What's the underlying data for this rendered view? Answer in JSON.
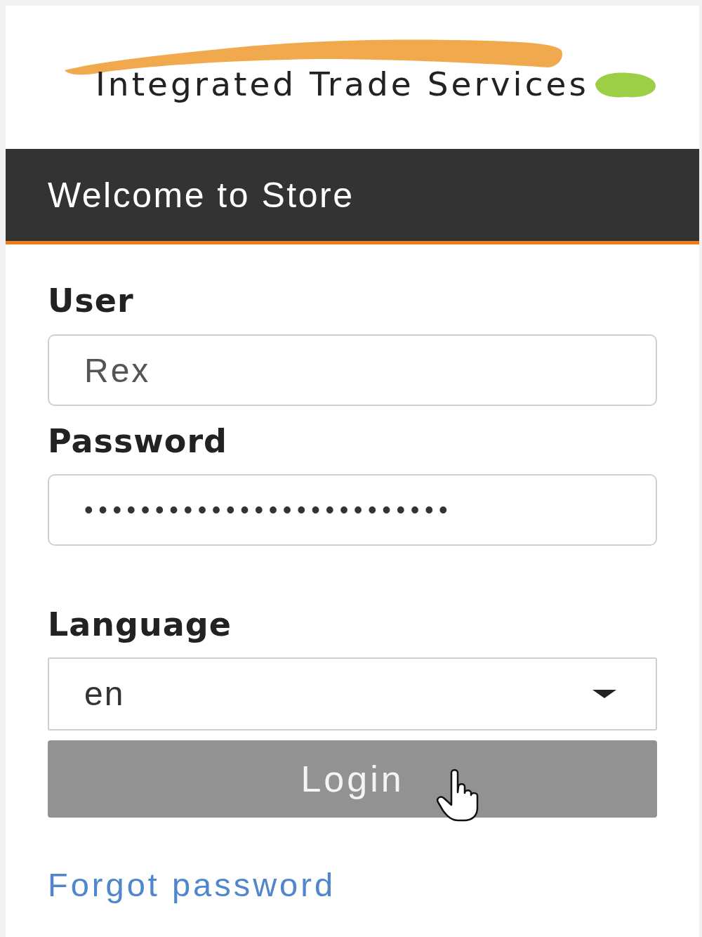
{
  "logo": {
    "text": "Integrated Trade Services"
  },
  "header": {
    "title": "Welcome to Store"
  },
  "fields": [
    {
      "kind": "text",
      "label": "User",
      "value": "Rex"
    },
    {
      "kind": "password",
      "label": "Password",
      "value": "••••••••••••••••••••••••••"
    },
    {
      "kind": "select",
      "label": "Language",
      "value": "en"
    }
  ],
  "login_button": {
    "label": "Login"
  },
  "forgot_link": {
    "label": "Forgot password"
  }
}
